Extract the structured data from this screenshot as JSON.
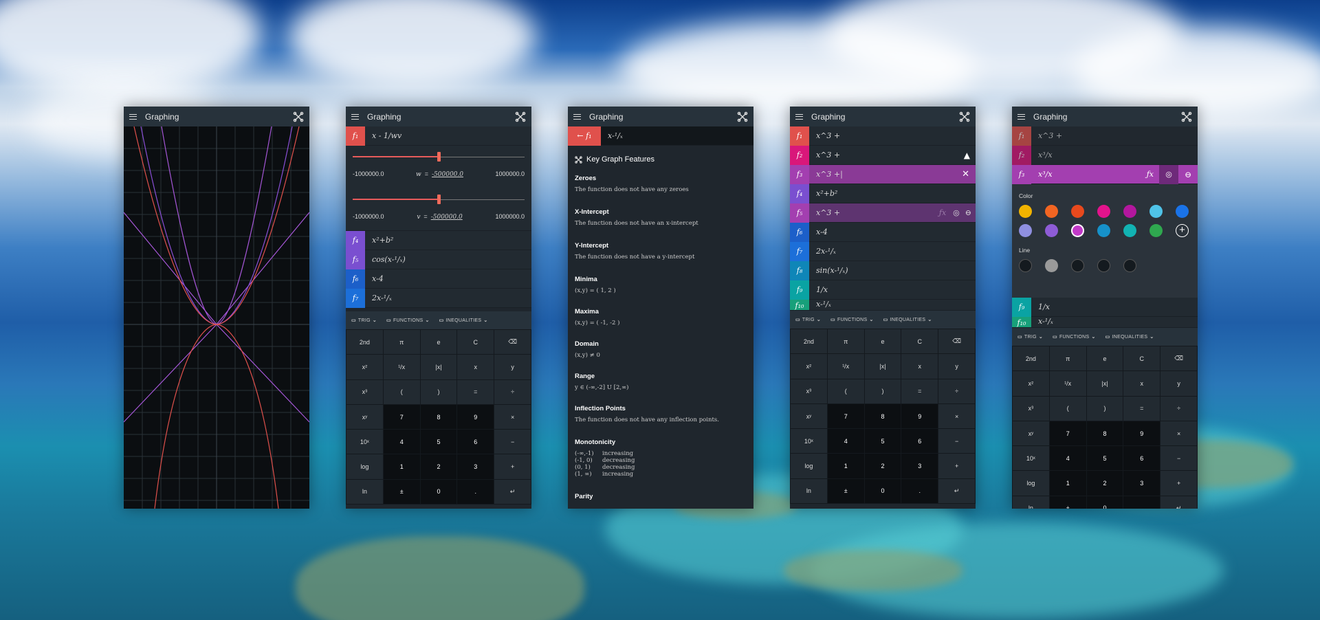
{
  "window_title": "Graphing",
  "w2": {
    "f1": {
      "label": "f₁",
      "expr": "x - 1/wv",
      "color": "#e0514c"
    },
    "slider_w": {
      "min": "-1000000.0",
      "max": "1000000.0",
      "var": "w",
      "eq": "=",
      "value": "-500000.0",
      "position": 0.5
    },
    "slider_v": {
      "min": "-1000000.0",
      "max": "1000000.0",
      "var": "v",
      "eq": "=",
      "value": "-500000.0",
      "position": 0.5
    },
    "funcs": [
      {
        "label": "f₄",
        "expr": "x²+b²",
        "color": "#7a4fd0"
      },
      {
        "label": "f₅",
        "expr": "cos(x-¹/ₓ)",
        "color": "#7a4fd0"
      },
      {
        "label": "f₆",
        "expr": "x-4",
        "color": "#1c5fc9"
      },
      {
        "label": "f₇",
        "expr": "2x-¹/ₓ",
        "color": "#1c6fd9"
      }
    ]
  },
  "toolbar": {
    "trig": "TRIG",
    "functions": "FUNCTIONS",
    "inequalities": "INEQUALITIES"
  },
  "keypad": [
    "2nd",
    "π",
    "e",
    "C",
    "⌫",
    "x²",
    "¹/x",
    "|x|",
    "x",
    "y",
    "x³",
    "(",
    ")",
    "=",
    "÷",
    "xʸ",
    "7",
    "8",
    "9",
    "×",
    "10ˣ",
    "4",
    "5",
    "6",
    "−",
    "log",
    "1",
    "2",
    "3",
    "+",
    "ln",
    "±",
    "0",
    ".",
    "↵"
  ],
  "w3": {
    "header": {
      "back": "←",
      "label": "f₁",
      "expr": "x-¹/ₓ"
    },
    "title": "Key Graph Features",
    "sections": [
      {
        "h": "Zeroes",
        "t": "The function does not have any zeroes"
      },
      {
        "h": "X-Intercept",
        "t": "The function does not have an x-intercept"
      },
      {
        "h": "Y-Intercept",
        "t": "The function does not have a y-intercept"
      },
      {
        "h": "Minima",
        "t": "(x,y) = ( 1, 2 )"
      },
      {
        "h": "Maxima",
        "t": "(x,y) = ( -1, -2 )"
      },
      {
        "h": "Domain",
        "t": "(x,y) ≠ 0"
      },
      {
        "h": "Range",
        "t": "y ∈ (-∞,-2] U [2,∞)"
      },
      {
        "h": "Inflection Points",
        "t": "The function does not have any inflection points."
      }
    ],
    "mono_title": "Monotonicity",
    "mono": [
      [
        "(-∞,-1)",
        "increasing"
      ],
      [
        "(-1, 0)",
        "decreasing"
      ],
      [
        "(0, 1)",
        "decreasing"
      ],
      [
        "(1, ∞)",
        "increasing"
      ]
    ],
    "parity": "Parity"
  },
  "w4": {
    "funcs": [
      {
        "label": "f₁",
        "expr": "x^3 +",
        "color": "#e0514c"
      },
      {
        "label": "f₂",
        "expr": "x^3 +",
        "color": "#d9177a"
      },
      {
        "label": "f₃",
        "expr": "x^3 +|",
        "color": "#a33fb0"
      },
      {
        "label": "f₄",
        "expr": "x²+b²",
        "color": "#7a4fd0"
      },
      {
        "label": "f₅",
        "expr": "x^3 +",
        "color": "#a33fb0"
      },
      {
        "label": "f₆",
        "expr": "x-4",
        "color": "#1c5fc9"
      },
      {
        "label": "f₇",
        "expr": "2x-¹/ₓ",
        "color": "#1c6fd9"
      },
      {
        "label": "f₈",
        "expr": "sin(x-¹/ₓ)",
        "color": "#0f86b8"
      },
      {
        "label": "f₉",
        "expr": "1/x",
        "color": "#0aa3a3"
      },
      {
        "label": "f₁₀",
        "expr": "x-¹/ₓ",
        "color": "#17a07a"
      }
    ],
    "fx": "ƒx"
  },
  "w5": {
    "funcs_top": [
      {
        "label": "f₁",
        "expr": "x^3 +",
        "color": "#e0514c"
      },
      {
        "label": "f₂",
        "expr": "x³/x",
        "color": "#d9177a"
      },
      {
        "label": "f₃",
        "expr": "x³/x",
        "color": "#a33fb0"
      }
    ],
    "fx": "ƒx",
    "color_label": "Color",
    "colors": [
      "#f2b400",
      "#f26522",
      "#e8491d",
      "#e3138c",
      "#b3179e",
      "#4fc3e8",
      "#1a73e8",
      "#8f8fe0",
      "#8e5cd6",
      "#c239c9",
      "#1691c9",
      "#12b3b3",
      "#2fa84f"
    ],
    "line_label": "Line",
    "line_colors": [
      "#141a1f",
      "#9a9a9a",
      "#141a1f",
      "#141a1f",
      "#141a1f"
    ],
    "funcs_bottom": [
      {
        "label": "f₉",
        "expr": "1/x",
        "color": "#0aa3a3"
      },
      {
        "label": "f₁₀",
        "expr": "x-¹/ₓ",
        "color": "#17a07a"
      }
    ]
  }
}
